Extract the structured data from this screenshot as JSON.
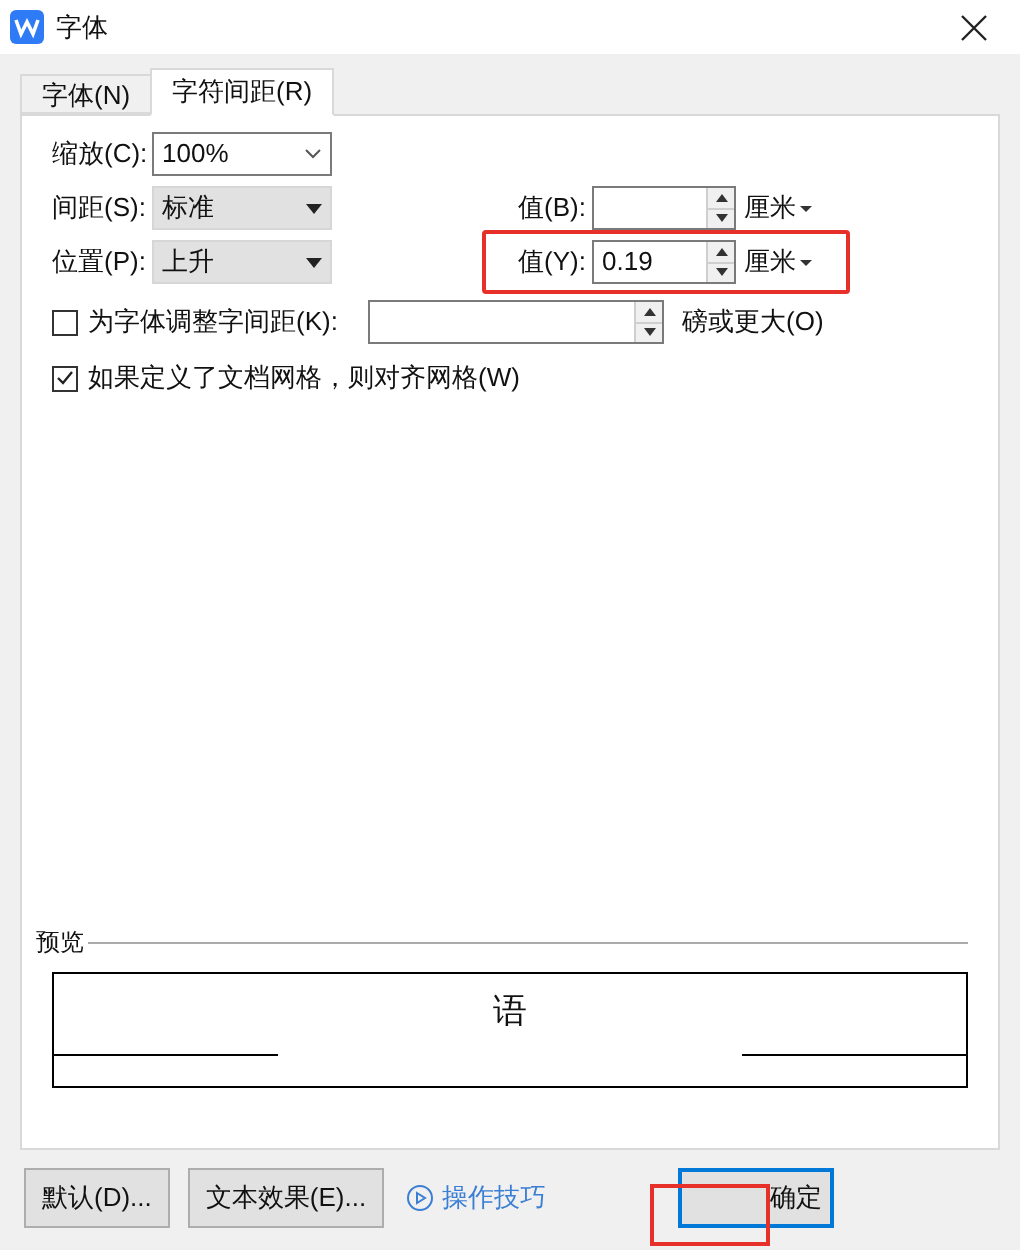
{
  "window": {
    "title": "字体"
  },
  "tabs": [
    {
      "label": "字体(N)",
      "selected": false
    },
    {
      "label": "字符间距(R)",
      "selected": true
    }
  ],
  "scale": {
    "label": "缩放(C):",
    "value": "100%"
  },
  "spacing": {
    "label": "间距(S):",
    "value": "标准",
    "by": {
      "label": "值(B):",
      "unit": "厘米"
    }
  },
  "position": {
    "label": "位置(P):",
    "value": "上升",
    "by": {
      "label": "值(Y):",
      "value": "0.19",
      "unit": "厘米"
    }
  },
  "kerning": {
    "label": "为字体调整字间距(K):",
    "checked": false,
    "suffix": "磅或更大(O)"
  },
  "snap_to_grid": {
    "label": "如果定义了文档网格，则对齐网格(W)",
    "checked": true
  },
  "preview": {
    "label": "预览",
    "sample": "语"
  },
  "buttons": [
    {
      "kind": "button",
      "label": "默认(D)..."
    },
    {
      "kind": "button",
      "label": "文本效果(E)..."
    },
    {
      "kind": "link",
      "label": "操作技巧"
    }
  ],
  "ok_button": {
    "label": "确定"
  }
}
